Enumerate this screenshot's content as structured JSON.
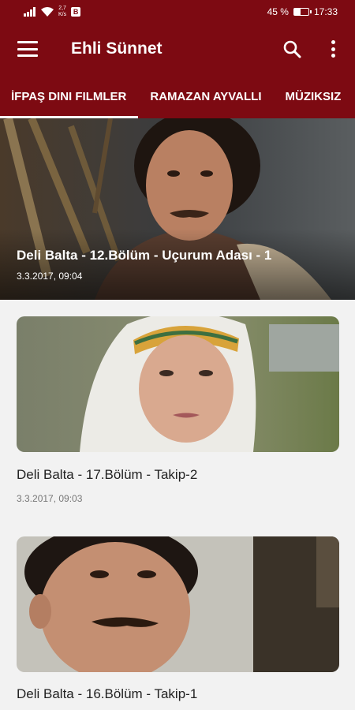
{
  "status": {
    "speed_value": "2,7",
    "speed_unit": "K/s",
    "b_badge": "B",
    "battery": "45 %",
    "battery_level": 0.45,
    "time": "17:33"
  },
  "app": {
    "title": "Ehli Sünnet"
  },
  "tabs": [
    {
      "label": "İFPAŞ DINI FILMLER",
      "active": true
    },
    {
      "label": "RAMAZAN AYVALLI",
      "active": false
    },
    {
      "label": "MÜZIKSIZ",
      "active": false
    }
  ],
  "featured": {
    "title": "Deli Balta - 12.Bölüm - Uçurum Adası - 1",
    "date": "3.3.2017, 09:04"
  },
  "videos": [
    {
      "title": "Deli Balta - 17.Bölüm - Takip-2",
      "date": "3.3.2017, 09:03"
    },
    {
      "title": "Deli Balta - 16.Bölüm - Takip-1",
      "date": ""
    }
  ],
  "colors": {
    "primary": "#7d0a12",
    "background": "#f2f2f2"
  },
  "icons": {
    "menu": "menu-icon",
    "search": "search-icon",
    "more": "more-vert-icon"
  }
}
